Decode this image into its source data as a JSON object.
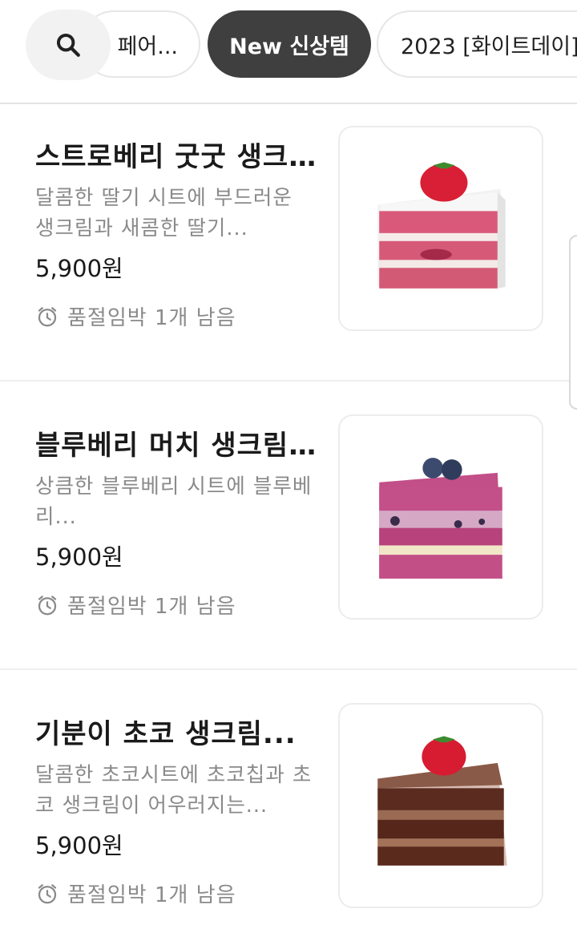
{
  "search": {
    "icon": "search-icon"
  },
  "chips": [
    {
      "label": "페어..."
    },
    {
      "label": "New 신상템",
      "selected": true
    },
    {
      "label": "2023 [화이트데이]"
    }
  ],
  "items": [
    {
      "title": "스트로베리 굿굿 생크림케이크",
      "desc": "달콤한 딸기 시트에 부드러운 생크림과 새콤한 딸기...",
      "price": "5,900원",
      "stock": "품절임박 1개 남음",
      "image": "strawberry-cake-slice"
    },
    {
      "title": "블루베리 머치 생크림케이크",
      "desc": "상큼한 블루베리 시트에 블루베리...",
      "price": "5,900원",
      "stock": "품절임박 1개 남음",
      "image": "blueberry-cake-slice"
    },
    {
      "title": "기분이 초코 생크림...",
      "desc": "달콤한 초코시트에 초코칩과 초코 생크림이 어우러지는...",
      "price": "5,900원",
      "stock": "품절임박 1개 남음",
      "image": "chocolate-cake-slice"
    }
  ],
  "colors": {
    "chip_selected": "#3f3f3f",
    "text_primary": "#1a1a1a",
    "text_secondary": "#8a8a8a"
  }
}
